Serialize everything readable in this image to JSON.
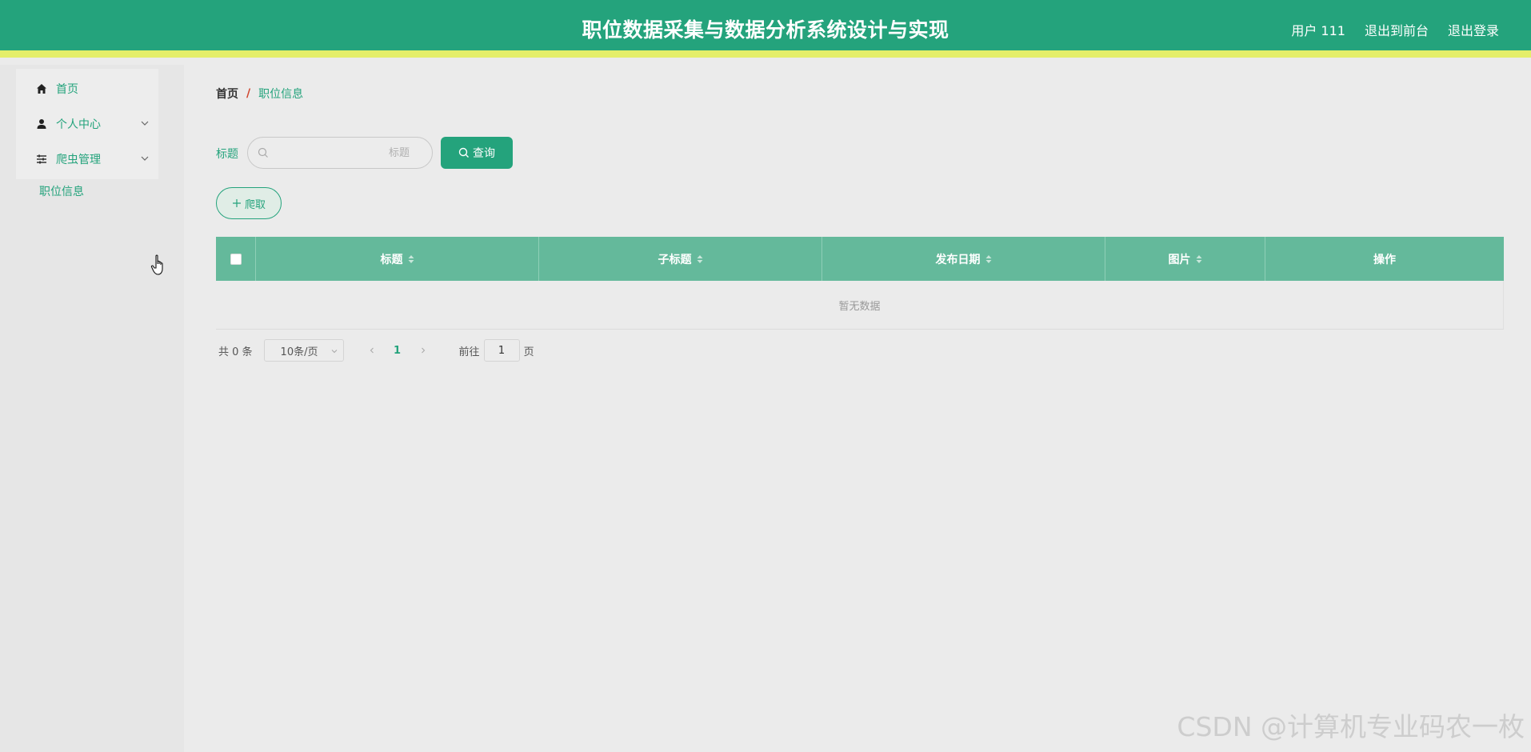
{
  "header": {
    "title": "职位数据采集与数据分析系统设计与实现",
    "user_label": "用户 111",
    "back_front_label": "退出到前台",
    "logout_label": "退出登录"
  },
  "sidebar": {
    "items": [
      {
        "label": "首页",
        "icon": "home-icon"
      },
      {
        "label": "个人中心",
        "icon": "user-icon"
      },
      {
        "label": "爬虫管理",
        "icon": "sliders-icon"
      }
    ],
    "sub_items": [
      {
        "label": "职位信息"
      }
    ]
  },
  "breadcrumb": {
    "home": "首页",
    "separator": "/",
    "current": "职位信息"
  },
  "search": {
    "label": "标题",
    "placeholder": "标题",
    "value": "",
    "button_label": "查询"
  },
  "crawl_button_label": "爬取",
  "table": {
    "columns": [
      "标题",
      "子标题",
      "发布日期",
      "图片",
      "操作"
    ],
    "rows": [],
    "empty_text": "暂无数据"
  },
  "pagination": {
    "total_text": "共 0 条",
    "page_size": "10条/页",
    "current_page": "1",
    "goto_label": "前往",
    "goto_value": "1",
    "page_suffix": "页"
  },
  "watermark": "CSDN @计算机专业码农一枚",
  "colors": {
    "primary": "#24a37c",
    "header_accent": "#e4ee6a",
    "table_header": "#64b99b"
  }
}
